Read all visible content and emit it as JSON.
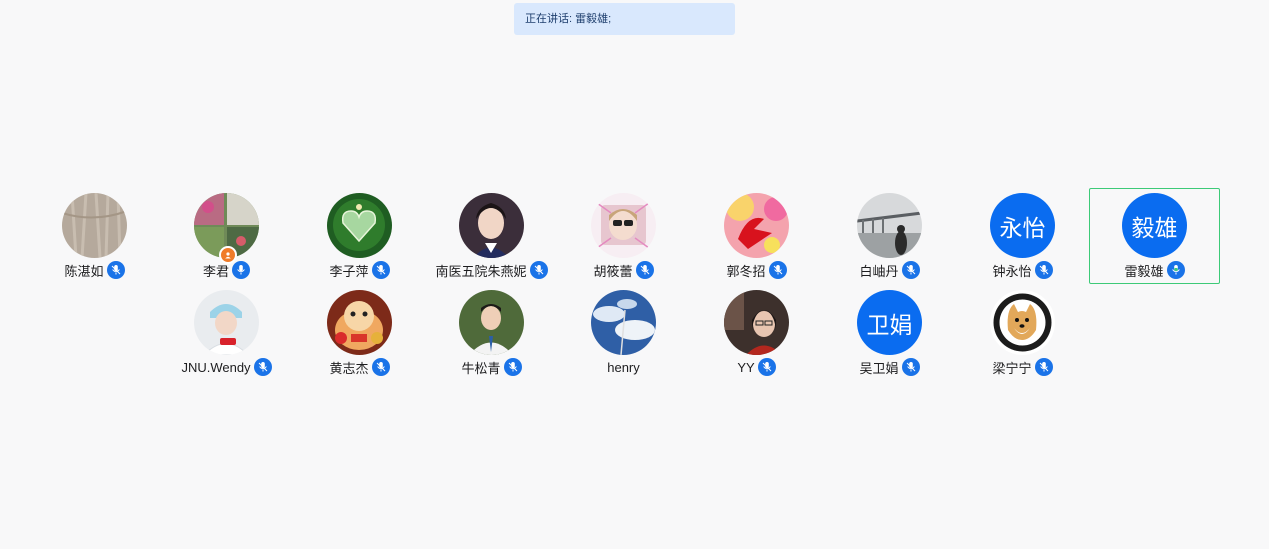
{
  "banner": {
    "text": "正在讲话: 雷毅雄;"
  },
  "colors": {
    "text_avatar_bg": "#0a6cf0",
    "active_border": "#3dca78",
    "mic_bg": "#1a73e8"
  },
  "participants": [
    {
      "name": "陈湛如",
      "avatar": "photo-wood",
      "mic": "mic-muted-icon"
    },
    {
      "name": "李君",
      "avatar": "photo-flowers",
      "mic": "mic-icon",
      "host": true
    },
    {
      "name": "李子萍",
      "avatar": "photo-green-heart",
      "mic": "mic-muted-icon"
    },
    {
      "name": "南医五院朱燕妮",
      "avatar": "photo-portrait",
      "mic": "mic-muted-icon"
    },
    {
      "name": "胡筱蕾",
      "avatar": "photo-girl",
      "mic": "mic-muted-icon"
    },
    {
      "name": "郭冬招",
      "avatar": "photo-red-character",
      "mic": "mic-muted-icon"
    },
    {
      "name": "白岫丹",
      "avatar": "photo-bridge",
      "mic": "mic-muted-icon"
    },
    {
      "name": "钟永怡",
      "avatar_text": "永怡",
      "mic": "mic-muted-icon"
    },
    {
      "name": "雷毅雄",
      "avatar_text": "毅雄",
      "mic": "mic-speaking-icon",
      "active": true
    },
    {
      "name": "JNU.Wendy",
      "avatar": "photo-nurse",
      "mic": "mic-muted-icon"
    },
    {
      "name": "黄志杰",
      "avatar": "photo-lucky-cat",
      "mic": "mic-muted-icon"
    },
    {
      "name": "牛松青",
      "avatar": "photo-man-suit",
      "mic": "mic-muted-icon"
    },
    {
      "name": "henry",
      "avatar": "photo-sky",
      "mic": ""
    },
    {
      "name": "YY",
      "avatar": "photo-woman-glasses",
      "mic": "mic-muted-icon"
    },
    {
      "name": "吴卫娟",
      "avatar_text": "卫娟",
      "mic": "mic-muted-icon"
    },
    {
      "name": "梁宁宁",
      "avatar": "photo-dog-logo",
      "mic": "mic-muted-icon"
    }
  ]
}
